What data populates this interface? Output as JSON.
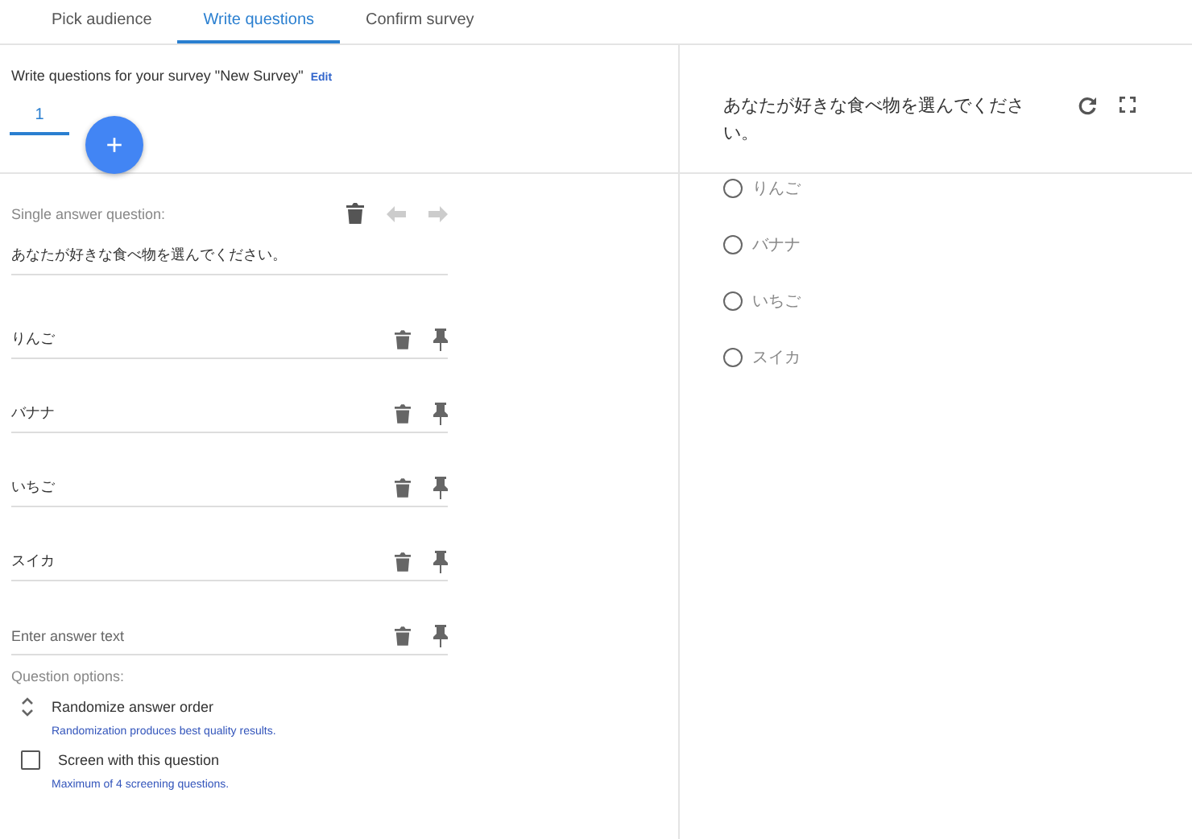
{
  "tabs": [
    {
      "label": "Pick audience",
      "selected": false
    },
    {
      "label": "Write questions",
      "selected": true
    },
    {
      "label": "Confirm survey",
      "selected": false
    }
  ],
  "heading": {
    "text": "Write questions for your survey \"New Survey\"",
    "edit_link": "Edit"
  },
  "question_tabs": [
    {
      "label": "1",
      "selected": true
    }
  ],
  "add_button": "+",
  "editor": {
    "type_label": "Single answer question:",
    "question": "あなたが好きな食べ物を選んでください。",
    "answers": [
      {
        "value": "りんご"
      },
      {
        "value": "バナナ"
      },
      {
        "value": "いちご"
      },
      {
        "value": "スイカ"
      },
      {
        "placeholder": "Enter answer text"
      }
    ],
    "options_title": "Question options:",
    "options": [
      {
        "kind": "sort",
        "label": "Randomize answer order",
        "hint": "Randomization produces best quality results."
      },
      {
        "kind": "checkbox",
        "label": "Screen with this question",
        "checked": false,
        "hint": "Maximum of 4 screening questions."
      }
    ]
  },
  "preview": {
    "question": "あなたが好きな食べ物を選んでください。",
    "choices": [
      {
        "label": "りんご",
        "selected": false
      },
      {
        "label": "バナナ",
        "selected": false
      },
      {
        "label": "いちご",
        "selected": false
      },
      {
        "label": "スイカ",
        "selected": false
      }
    ]
  }
}
